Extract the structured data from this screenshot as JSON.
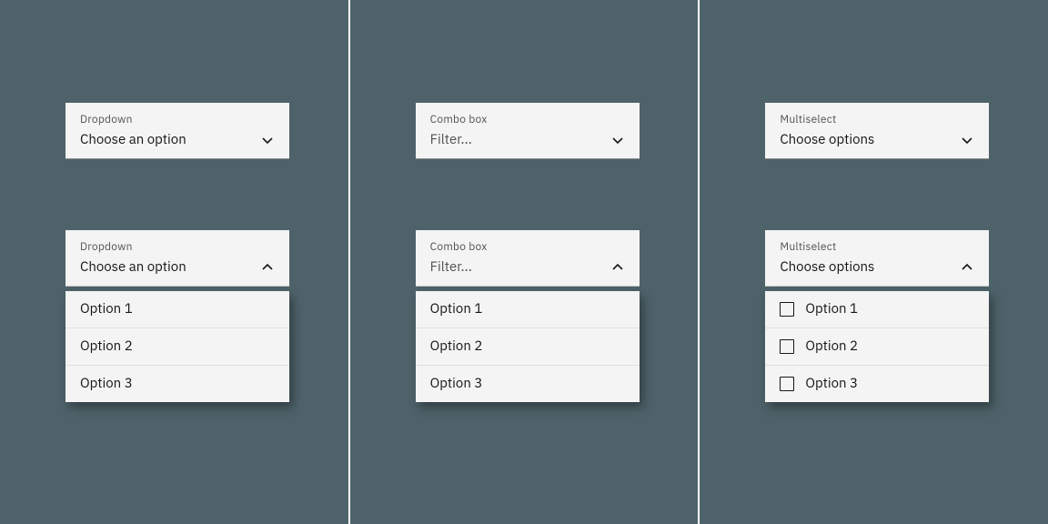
{
  "columns": [
    {
      "key": "dropdown",
      "label": "Dropdown",
      "value": "Choose an option",
      "placeholder": false,
      "hasCheckbox": false,
      "options": [
        "Option 1",
        "Option 2",
        "Option 3"
      ]
    },
    {
      "key": "combobox",
      "label": "Combo box",
      "value": "Filter...",
      "placeholder": true,
      "hasCheckbox": false,
      "options": [
        "Option 1",
        "Option 2",
        "Option 3"
      ]
    },
    {
      "key": "multiselect",
      "label": "Multiselect",
      "value": "Choose options",
      "placeholder": false,
      "hasCheckbox": true,
      "options": [
        "Option 1",
        "Option 2",
        "Option 3"
      ]
    }
  ]
}
